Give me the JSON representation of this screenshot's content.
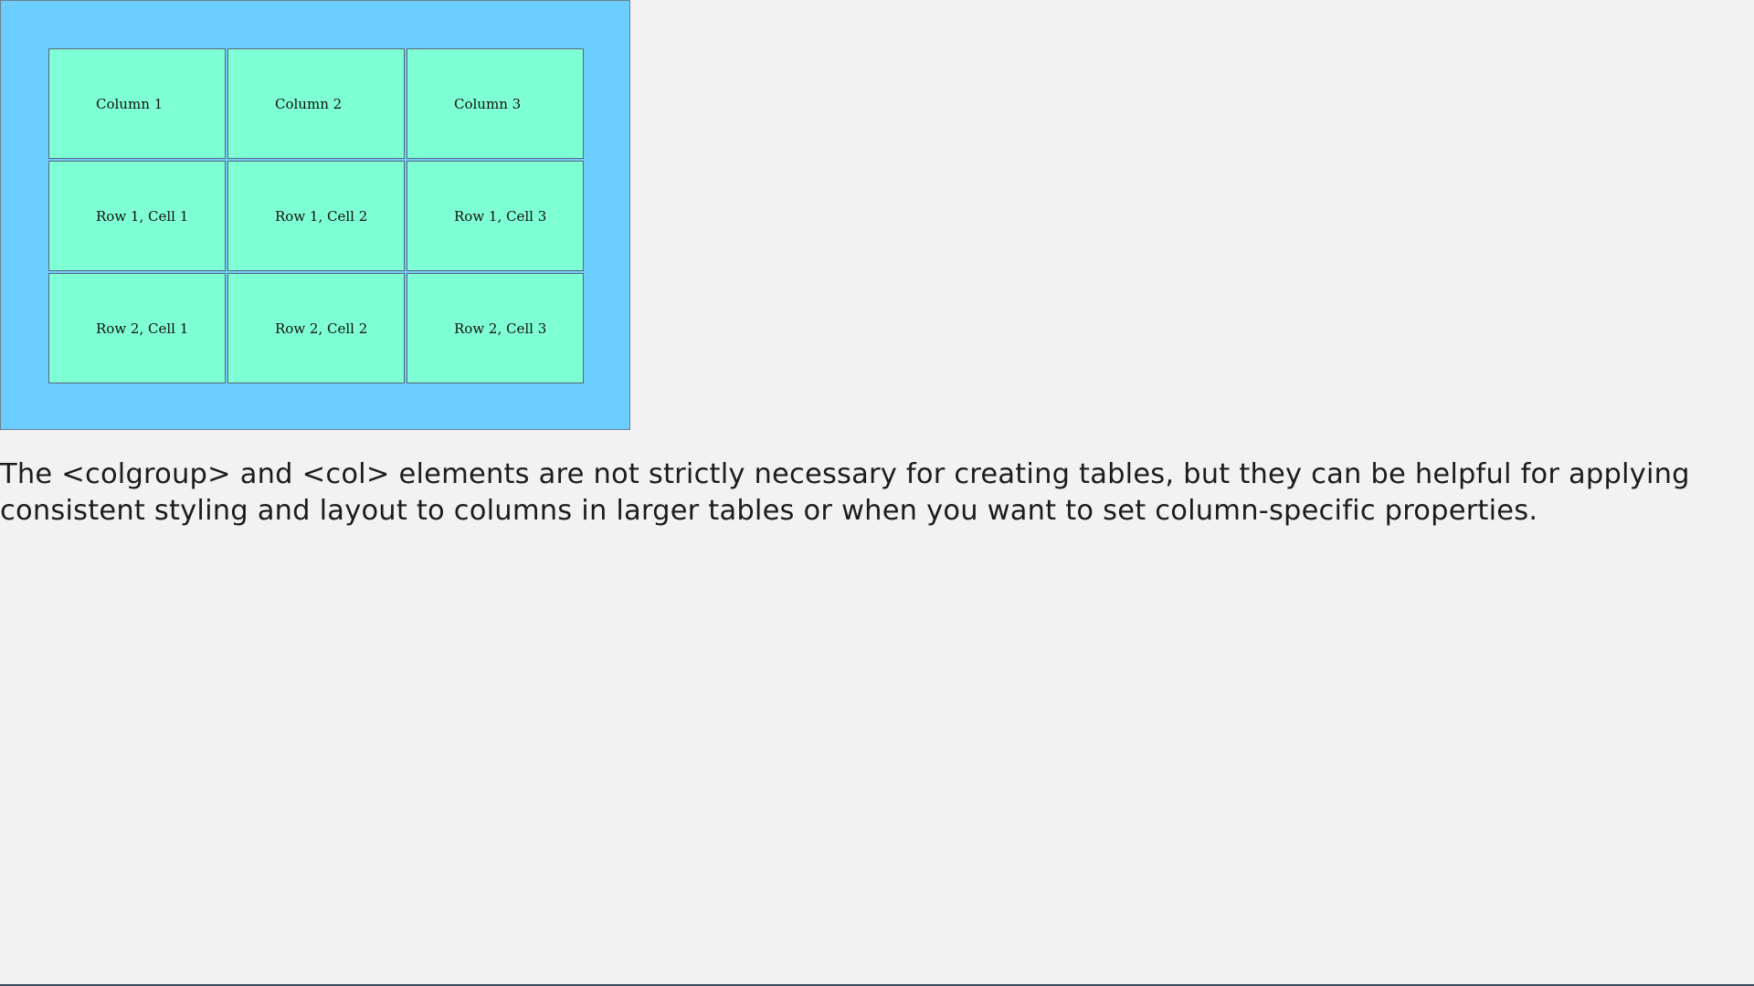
{
  "table": {
    "header": [
      "Column 1",
      "Column 2",
      "Column 3"
    ],
    "rows": [
      [
        "Row 1, Cell 1",
        "Row 1, Cell 2",
        "Row 1, Cell 3"
      ],
      [
        "Row 2, Cell 1",
        "Row 2, Cell 2",
        "Row 2, Cell 3"
      ]
    ],
    "colors": {
      "frame_background": "#6ccdff",
      "cell_background": "#7fffd4",
      "cell_border": "#5b6677"
    }
  },
  "paragraph": {
    "text": "The <colgroup> and <col> elements are not strictly necessary for creating tables, but they can be helpful for applying consistent styling and layout to columns in larger tables or when you want to set column-specific properties."
  },
  "page": {
    "background": "#f2f2f2"
  }
}
